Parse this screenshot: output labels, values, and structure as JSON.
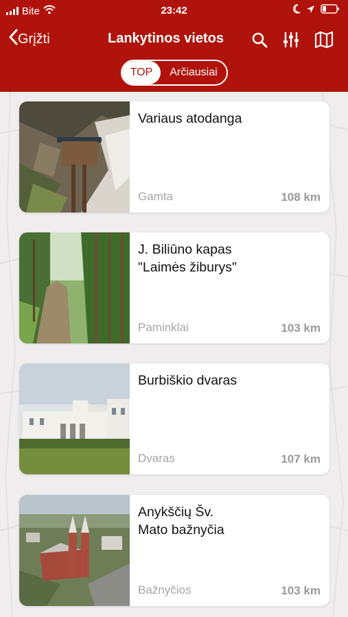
{
  "status_bar": {
    "carrier": "Bite",
    "time": "23:42"
  },
  "nav": {
    "back_label": "Grįžti",
    "title": "Lankytinos vietos",
    "icons": [
      "search-icon",
      "filter-sliders-icon",
      "map-icon"
    ]
  },
  "tabs": {
    "top": "TOP",
    "nearest": "Arčiausiai",
    "selected": "TOP"
  },
  "colors": {
    "brand": "#b0130b",
    "card_bg": "#ffffff",
    "muted_text": "#a5a5a5"
  },
  "places": [
    {
      "name": "Variaus atodanga",
      "category": "Gamta",
      "distance": "108 km"
    },
    {
      "name": "J. Biliūno kapas\n\"Laimės žiburys\"",
      "category": "Paminklai",
      "distance": "103 km"
    },
    {
      "name": "Burbiškio dvaras",
      "category": "Dvaras",
      "distance": "107 km"
    },
    {
      "name": "Anykščių Šv.\nMato bažnyčia",
      "category": "Bažnyčios",
      "distance": "103 km"
    }
  ]
}
